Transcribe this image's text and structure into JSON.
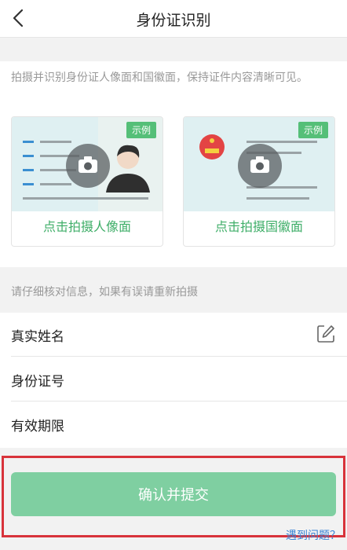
{
  "header": {
    "title": "身份证识别"
  },
  "instructions": "拍摄并识别身份证人像面和国徽面，保持证件内容清晰可见。",
  "cards": [
    {
      "badge": "示例",
      "label": "点击拍摄人像面"
    },
    {
      "badge": "示例",
      "label": "点击拍摄国徽面"
    }
  ],
  "verify_hint": "请仔细核对信息，如果有误请重新拍摄",
  "form": {
    "rows": [
      {
        "label": "真实姓名"
      },
      {
        "label": "身份证号"
      },
      {
        "label": "有效期限"
      }
    ]
  },
  "submit_label": "确认并提交",
  "help_link": "遇到问题？",
  "icons": [
    "back-icon",
    "camera-icon",
    "edit-icon"
  ],
  "colors": {
    "accent_green": "#55bf78",
    "label_green": "#3fae68",
    "submit_bg": "#7fcfa1",
    "highlight_red": "#d8333b",
    "link_blue": "#3a84d6"
  }
}
